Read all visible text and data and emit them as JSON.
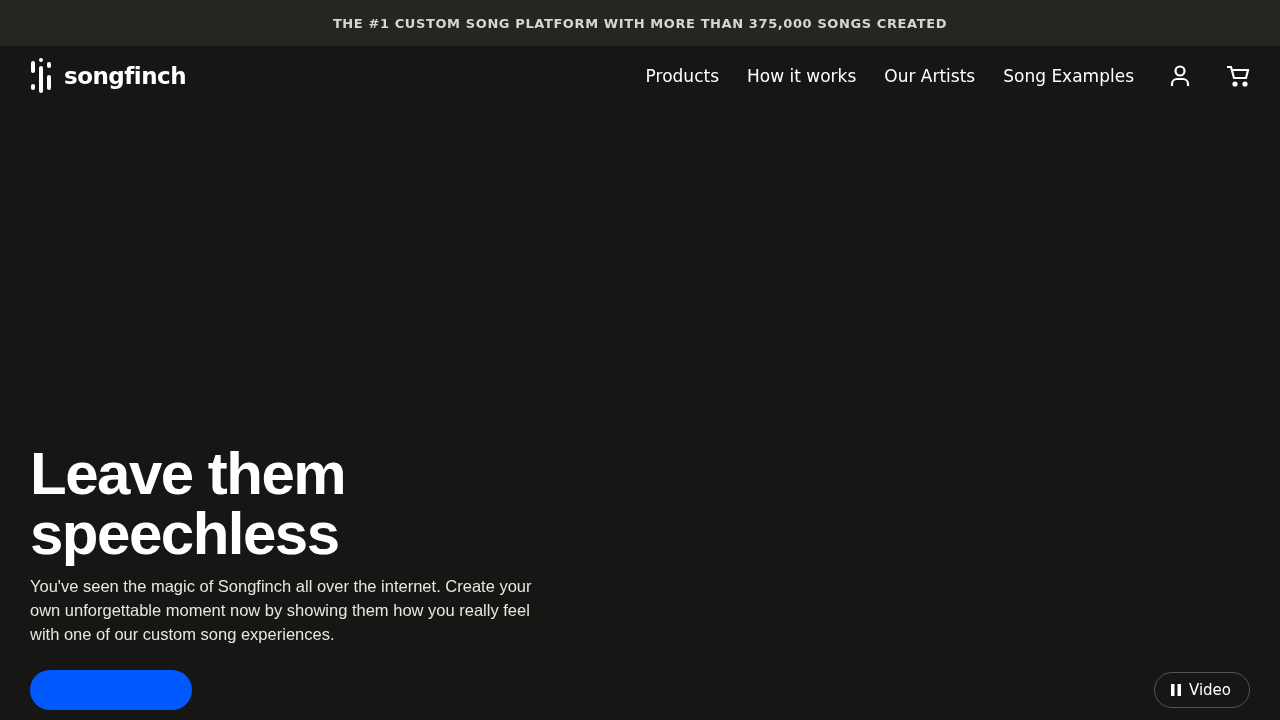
{
  "announcement": "THE #1 CUSTOM SONG PLATFORM WITH MORE THAN 375,000 SONGS CREATED",
  "logo": "songfinch",
  "nav": [
    "Products",
    "How it works",
    "Our Artists",
    "Song Examples"
  ],
  "hero": {
    "title": "Leave them speechless",
    "text": "You've seen the magic of Songfinch all over the internet. Create your own unforgettable moment now by showing them how you really feel with one of our custom song experiences."
  },
  "video_button": {
    "label": "Video"
  }
}
